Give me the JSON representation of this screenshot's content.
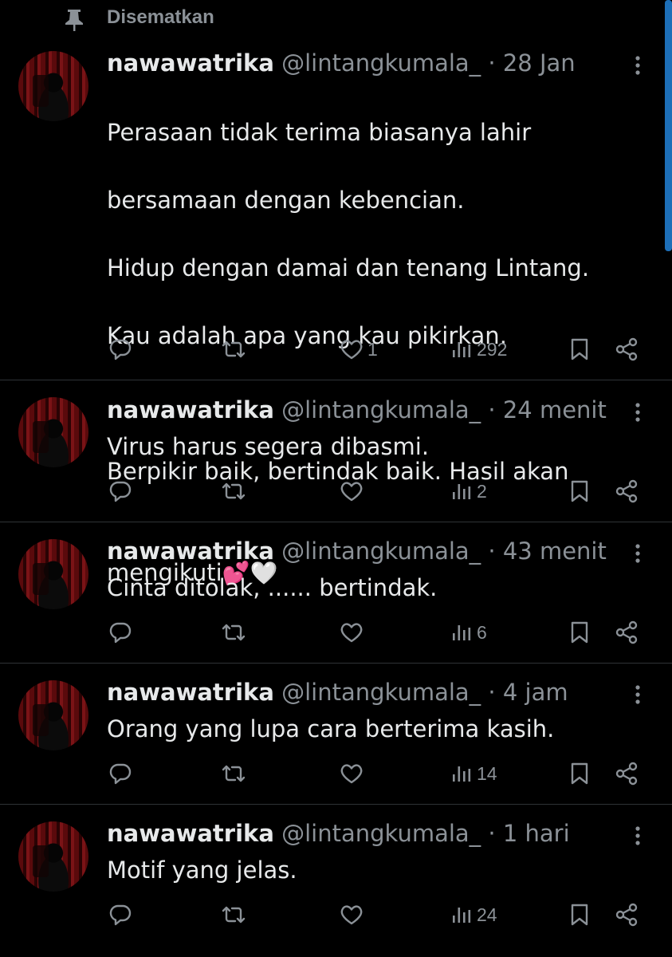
{
  "pinned": {
    "label": "Disematkan"
  },
  "tweets": [
    {
      "name": "nawawatrika",
      "handle": "@lintangkumala_",
      "time": "28 Jan",
      "lines": [
        "Perasaan tidak terima biasanya lahir",
        "bersamaan dengan kebencian.",
        "Hidup dengan damai dan tenang Lintang.",
        "Kau adalah apa yang kau pikirkan.",
        "",
        "Berpikir baik, bertindak baik. Hasil akan"
      ],
      "last_line_text": "mengikuti",
      "last_line_emojis": [
        "💕",
        "🤍"
      ],
      "likes": "1",
      "views": "292"
    },
    {
      "name": "nawawatrika",
      "handle": "@lintangkumala_",
      "time": "24 menit",
      "text": "Virus harus segera dibasmi.",
      "views": "2"
    },
    {
      "name": "nawawatrika",
      "handle": "@lintangkumala_",
      "time": "43 menit",
      "text": "Cinta ditolak, ...... bertindak.",
      "views": "6"
    },
    {
      "name": "nawawatrika",
      "handle": "@lintangkumala_",
      "time": "4 jam",
      "text": "Orang yang lupa cara berterima kasih.",
      "views": "14"
    },
    {
      "name": "nawawatrika",
      "handle": "@lintangkumala_",
      "time": "1 hari",
      "text": "Motif yang jelas.",
      "views": "24"
    }
  ],
  "icons": {
    "pin": "pin-icon",
    "more": "more-icon",
    "reply": "reply-icon",
    "retweet": "retweet-icon",
    "like": "like-icon",
    "views": "views-icon",
    "bookmark": "bookmark-icon",
    "share": "share-icon"
  },
  "colors": {
    "background": "#000000",
    "text": "#e7e9ea",
    "muted": "#8b9197",
    "divider": "#2f3336",
    "scrollbar": "#1d6fb8"
  }
}
